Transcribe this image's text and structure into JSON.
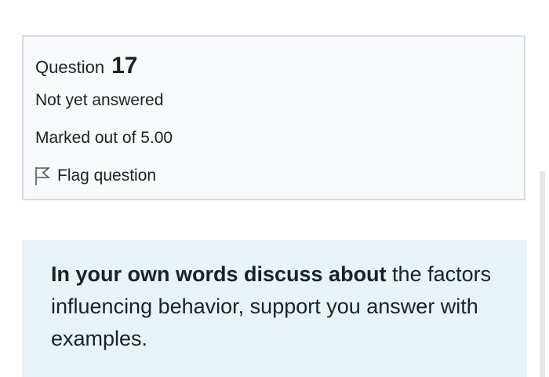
{
  "question": {
    "prefix": "Question",
    "number": "17",
    "state": "Not yet answered",
    "grade": "Marked out of 5.00",
    "flag_label": "Flag question"
  },
  "content": {
    "bold_text": "In your own words discuss about",
    "rest_text": " the factors influencing behavior, support you answer with examples."
  },
  "icons": {
    "flag": "flag-outline-icon"
  },
  "colors": {
    "info_background": "#f8f9fa",
    "info_border": "#d9d9e3",
    "content_background": "#e7f3f5",
    "text": "#1d2125"
  }
}
